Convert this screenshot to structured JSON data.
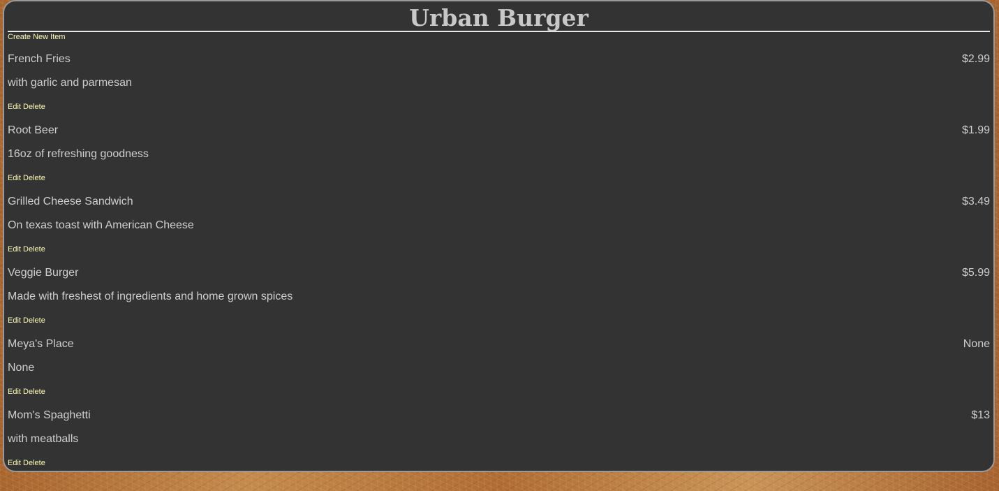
{
  "restaurant": {
    "name": "Urban Burger"
  },
  "actions": {
    "create_label": "Create New Item",
    "edit_label": "Edit",
    "delete_label": "Delete"
  },
  "menu_items": [
    {
      "name": "French Fries",
      "price": "$2.99",
      "description": "with garlic and parmesan"
    },
    {
      "name": "Root Beer",
      "price": "$1.99",
      "description": "16oz of refreshing goodness"
    },
    {
      "name": "Grilled Cheese Sandwich",
      "price": "$3.49",
      "description": "On texas toast with American Cheese"
    },
    {
      "name": "Veggie Burger",
      "price": "$5.99",
      "description": "Made with freshest of ingredients and home grown spices"
    },
    {
      "name": "Meya's Place",
      "price": "None",
      "description": "None"
    },
    {
      "name": "Mom's Spaghetti",
      "price": "$13",
      "description": "with meatballs"
    }
  ],
  "colors": {
    "panel_background": "#333333",
    "link": "#fdfbb8",
    "text": "#cfcfcf",
    "title": "#c8c8c8"
  }
}
